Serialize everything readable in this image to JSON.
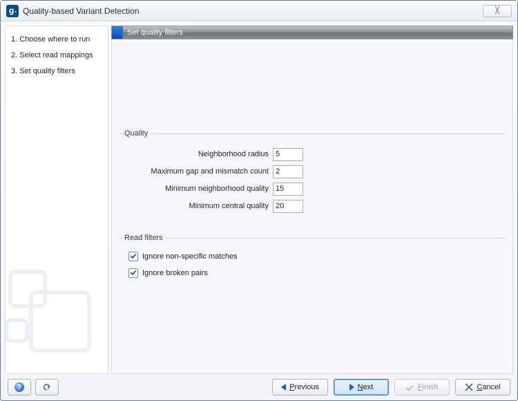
{
  "title": "Quality-based Variant Detection",
  "steps": {
    "items": [
      {
        "label": "Choose where to run"
      },
      {
        "label": "Select read mappings"
      },
      {
        "label": "Set quality filters"
      }
    ]
  },
  "stepHeader": "Set quality filters",
  "groups": {
    "quality": {
      "legend": "Quality",
      "fields": {
        "neighborhood_radius": {
          "label": "Neighborhood radius",
          "value": "5"
        },
        "max_gap_mismatch": {
          "label": "Maximum gap and mismatch count",
          "value": "2"
        },
        "min_neigh_quality": {
          "label": "Minimum neighborhood quality",
          "value": "15"
        },
        "min_central_quality": {
          "label": "Minimum central quality",
          "value": "20"
        }
      }
    },
    "readfilters": {
      "legend": "Read filters",
      "ignore_non_specific": {
        "label": "Ignore non-specific matches",
        "checked": true
      },
      "ignore_broken_pairs": {
        "label": "Ignore broken pairs",
        "checked": true
      }
    }
  },
  "buttons": {
    "help": "?",
    "previous_prefix": "P",
    "previous_rest": "revious",
    "next_prefix": "N",
    "next_rest": "ext",
    "finish_prefix": "F",
    "finish_rest": "inish",
    "cancel_prefix": "C",
    "cancel_rest": "ancel"
  },
  "close_glyph": "╳"
}
